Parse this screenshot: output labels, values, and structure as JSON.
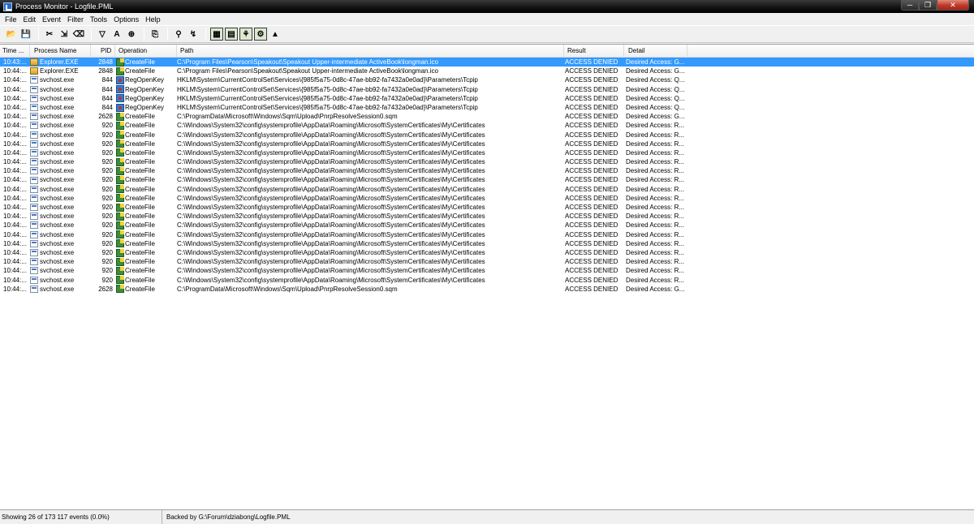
{
  "window": {
    "title": "Process Monitor - Logfile.PML"
  },
  "menu": [
    "File",
    "Edit",
    "Event",
    "Filter",
    "Tools",
    "Options",
    "Help"
  ],
  "toolbar": {
    "buttons": [
      {
        "name": "open-icon",
        "glyph": "📂"
      },
      {
        "name": "save-icon",
        "glyph": "💾"
      },
      {
        "name": "capture-icon",
        "glyph": "✂"
      },
      {
        "name": "autoscroll-icon",
        "glyph": "⇲"
      },
      {
        "name": "clear-icon",
        "glyph": "⌫"
      },
      {
        "name": "filter-icon",
        "glyph": "▽"
      },
      {
        "name": "highlight-icon",
        "glyph": "A"
      },
      {
        "name": "include-process-icon",
        "glyph": "⊕"
      },
      {
        "name": "jump-icon",
        "glyph": "⎘"
      },
      {
        "name": "find-icon",
        "glyph": "⚲"
      },
      {
        "name": "jump-to-icon",
        "glyph": "↯"
      },
      {
        "name": "registry-activity-icon",
        "glyph": "▦"
      },
      {
        "name": "filesystem-activity-icon",
        "glyph": "▤"
      },
      {
        "name": "network-activity-icon",
        "glyph": "⚘"
      },
      {
        "name": "process-activity-icon",
        "glyph": "⚙"
      },
      {
        "name": "profiling-icon",
        "glyph": "▲"
      }
    ]
  },
  "columns": [
    "Time ...",
    "Process Name",
    "PID",
    "Operation",
    "Path",
    "Result",
    "Detail"
  ],
  "rows": [
    {
      "time": "10:43:...",
      "process": "Explorer.EXE",
      "pid": "2848",
      "op": "CreateFile",
      "path": "C:\\Program Files\\Pearson\\Speakout\\Speakout Upper-intermediate ActiveBook\\longman.ico",
      "result": "ACCESS DENIED",
      "detail": "Desired Access: G..."
    },
    {
      "time": "10:44:...",
      "process": "Explorer.EXE",
      "pid": "2848",
      "op": "CreateFile",
      "path": "C:\\Program Files\\Pearson\\Speakout\\Speakout Upper-intermediate ActiveBook\\longman.ico",
      "result": "ACCESS DENIED",
      "detail": "Desired Access: G..."
    },
    {
      "time": "10:44:...",
      "process": "svchost.exe",
      "pid": "844",
      "op": "RegOpenKey",
      "path": "HKLM\\System\\CurrentControlSet\\Services\\{985f5a75-0d8c-47ae-bb92-fa7432a0e0ad}\\Parameters\\Tcpip",
      "result": "ACCESS DENIED",
      "detail": "Desired Access: Q..."
    },
    {
      "time": "10:44:...",
      "process": "svchost.exe",
      "pid": "844",
      "op": "RegOpenKey",
      "path": "HKLM\\System\\CurrentControlSet\\Services\\{985f5a75-0d8c-47ae-bb92-fa7432a0e0ad}\\Parameters\\Tcpip",
      "result": "ACCESS DENIED",
      "detail": "Desired Access: Q..."
    },
    {
      "time": "10:44:...",
      "process": "svchost.exe",
      "pid": "844",
      "op": "RegOpenKey",
      "path": "HKLM\\System\\CurrentControlSet\\Services\\{985f5a75-0d8c-47ae-bb92-fa7432a0e0ad}\\Parameters\\Tcpip",
      "result": "ACCESS DENIED",
      "detail": "Desired Access: Q..."
    },
    {
      "time": "10:44:...",
      "process": "svchost.exe",
      "pid": "844",
      "op": "RegOpenKey",
      "path": "HKLM\\System\\CurrentControlSet\\Services\\{985f5a75-0d8c-47ae-bb92-fa7432a0e0ad}\\Parameters\\Tcpip",
      "result": "ACCESS DENIED",
      "detail": "Desired Access: Q..."
    },
    {
      "time": "10:44:...",
      "process": "svchost.exe",
      "pid": "2628",
      "op": "CreateFile",
      "path": "C:\\ProgramData\\Microsoft\\Windows\\Sqm\\Upload\\PnrpResolveSession0.sqm",
      "result": "ACCESS DENIED",
      "detail": "Desired Access: G..."
    },
    {
      "time": "10:44:...",
      "process": "svchost.exe",
      "pid": "920",
      "op": "CreateFile",
      "path": "C:\\Windows\\System32\\config\\systemprofile\\AppData\\Roaming\\Microsoft\\SystemCertificates\\My\\Certificates",
      "result": "ACCESS DENIED",
      "detail": "Desired Access: R..."
    },
    {
      "time": "10:44:...",
      "process": "svchost.exe",
      "pid": "920",
      "op": "CreateFile",
      "path": "C:\\Windows\\System32\\config\\systemprofile\\AppData\\Roaming\\Microsoft\\SystemCertificates\\My\\Certificates",
      "result": "ACCESS DENIED",
      "detail": "Desired Access: R..."
    },
    {
      "time": "10:44:...",
      "process": "svchost.exe",
      "pid": "920",
      "op": "CreateFile",
      "path": "C:\\Windows\\System32\\config\\systemprofile\\AppData\\Roaming\\Microsoft\\SystemCertificates\\My\\Certificates",
      "result": "ACCESS DENIED",
      "detail": "Desired Access: R..."
    },
    {
      "time": "10:44:...",
      "process": "svchost.exe",
      "pid": "920",
      "op": "CreateFile",
      "path": "C:\\Windows\\System32\\config\\systemprofile\\AppData\\Roaming\\Microsoft\\SystemCertificates\\My\\Certificates",
      "result": "ACCESS DENIED",
      "detail": "Desired Access: R..."
    },
    {
      "time": "10:44:...",
      "process": "svchost.exe",
      "pid": "920",
      "op": "CreateFile",
      "path": "C:\\Windows\\System32\\config\\systemprofile\\AppData\\Roaming\\Microsoft\\SystemCertificates\\My\\Certificates",
      "result": "ACCESS DENIED",
      "detail": "Desired Access: R..."
    },
    {
      "time": "10:44:...",
      "process": "svchost.exe",
      "pid": "920",
      "op": "CreateFile",
      "path": "C:\\Windows\\System32\\config\\systemprofile\\AppData\\Roaming\\Microsoft\\SystemCertificates\\My\\Certificates",
      "result": "ACCESS DENIED",
      "detail": "Desired Access: R..."
    },
    {
      "time": "10:44:...",
      "process": "svchost.exe",
      "pid": "920",
      "op": "CreateFile",
      "path": "C:\\Windows\\System32\\config\\systemprofile\\AppData\\Roaming\\Microsoft\\SystemCertificates\\My\\Certificates",
      "result": "ACCESS DENIED",
      "detail": "Desired Access: R..."
    },
    {
      "time": "10:44:...",
      "process": "svchost.exe",
      "pid": "920",
      "op": "CreateFile",
      "path": "C:\\Windows\\System32\\config\\systemprofile\\AppData\\Roaming\\Microsoft\\SystemCertificates\\My\\Certificates",
      "result": "ACCESS DENIED",
      "detail": "Desired Access: R..."
    },
    {
      "time": "10:44:...",
      "process": "svchost.exe",
      "pid": "920",
      "op": "CreateFile",
      "path": "C:\\Windows\\System32\\config\\systemprofile\\AppData\\Roaming\\Microsoft\\SystemCertificates\\My\\Certificates",
      "result": "ACCESS DENIED",
      "detail": "Desired Access: R..."
    },
    {
      "time": "10:44:...",
      "process": "svchost.exe",
      "pid": "920",
      "op": "CreateFile",
      "path": "C:\\Windows\\System32\\config\\systemprofile\\AppData\\Roaming\\Microsoft\\SystemCertificates\\My\\Certificates",
      "result": "ACCESS DENIED",
      "detail": "Desired Access: R..."
    },
    {
      "time": "10:44:...",
      "process": "svchost.exe",
      "pid": "920",
      "op": "CreateFile",
      "path": "C:\\Windows\\System32\\config\\systemprofile\\AppData\\Roaming\\Microsoft\\SystemCertificates\\My\\Certificates",
      "result": "ACCESS DENIED",
      "detail": "Desired Access: R..."
    },
    {
      "time": "10:44:...",
      "process": "svchost.exe",
      "pid": "920",
      "op": "CreateFile",
      "path": "C:\\Windows\\System32\\config\\systemprofile\\AppData\\Roaming\\Microsoft\\SystemCertificates\\My\\Certificates",
      "result": "ACCESS DENIED",
      "detail": "Desired Access: R..."
    },
    {
      "time": "10:44:...",
      "process": "svchost.exe",
      "pid": "920",
      "op": "CreateFile",
      "path": "C:\\Windows\\System32\\config\\systemprofile\\AppData\\Roaming\\Microsoft\\SystemCertificates\\My\\Certificates",
      "result": "ACCESS DENIED",
      "detail": "Desired Access: R..."
    },
    {
      "time": "10:44:...",
      "process": "svchost.exe",
      "pid": "920",
      "op": "CreateFile",
      "path": "C:\\Windows\\System32\\config\\systemprofile\\AppData\\Roaming\\Microsoft\\SystemCertificates\\My\\Certificates",
      "result": "ACCESS DENIED",
      "detail": "Desired Access: R..."
    },
    {
      "time": "10:44:...",
      "process": "svchost.exe",
      "pid": "920",
      "op": "CreateFile",
      "path": "C:\\Windows\\System32\\config\\systemprofile\\AppData\\Roaming\\Microsoft\\SystemCertificates\\My\\Certificates",
      "result": "ACCESS DENIED",
      "detail": "Desired Access: R..."
    },
    {
      "time": "10:44:...",
      "process": "svchost.exe",
      "pid": "920",
      "op": "CreateFile",
      "path": "C:\\Windows\\System32\\config\\systemprofile\\AppData\\Roaming\\Microsoft\\SystemCertificates\\My\\Certificates",
      "result": "ACCESS DENIED",
      "detail": "Desired Access: R..."
    },
    {
      "time": "10:44:...",
      "process": "svchost.exe",
      "pid": "920",
      "op": "CreateFile",
      "path": "C:\\Windows\\System32\\config\\systemprofile\\AppData\\Roaming\\Microsoft\\SystemCertificates\\My\\Certificates",
      "result": "ACCESS DENIED",
      "detail": "Desired Access: R..."
    },
    {
      "time": "10:44:...",
      "process": "svchost.exe",
      "pid": "920",
      "op": "CreateFile",
      "path": "C:\\Windows\\System32\\config\\systemprofile\\AppData\\Roaming\\Microsoft\\SystemCertificates\\My\\Certificates",
      "result": "ACCESS DENIED",
      "detail": "Desired Access: R..."
    },
    {
      "time": "10:44:...",
      "process": "svchost.exe",
      "pid": "2628",
      "op": "CreateFile",
      "path": "C:\\ProgramData\\Microsoft\\Windows\\Sqm\\Upload\\PnrpResolveSession0.sqm",
      "result": "ACCESS DENIED",
      "detail": "Desired Access: G..."
    }
  ],
  "status": {
    "events": "Showing 26 of 173 117 events (0.0%)",
    "backing": "Backed by G:\\Forum\\dziabong\\Logfile.PML"
  },
  "colors": {
    "selection": "#3399ff",
    "titlebar": "#000000"
  }
}
